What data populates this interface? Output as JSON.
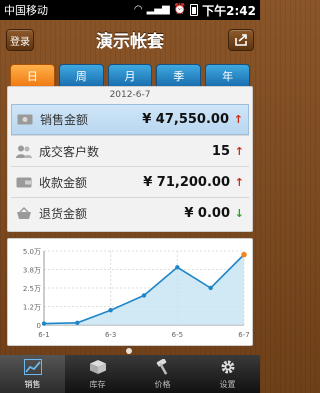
{
  "status_bar": {
    "carrier": "中国移动",
    "time": "下午2:42"
  },
  "header": {
    "left_button": "登录",
    "title": "演示帐套"
  },
  "period_tabs": [
    "日",
    "周",
    "月",
    "季",
    "年"
  ],
  "active_tab": "日",
  "summary": {
    "date": "2012-6-7",
    "rows": [
      {
        "icon": "cash-icon",
        "label": "销售金额",
        "value": "¥ 47,550.00",
        "trend": "↑"
      },
      {
        "icon": "customers-icon",
        "label": "成交客户数",
        "value": "15",
        "trend": "↑"
      },
      {
        "icon": "wallet-icon",
        "label": "收款金额",
        "value": "¥ 71,200.00",
        "trend": "↑"
      },
      {
        "icon": "basket-icon",
        "label": "退货金额",
        "value": "¥ 0.00",
        "trend": "↓"
      }
    ]
  },
  "chart_data": {
    "type": "area",
    "x": [
      "6-1",
      "6-2",
      "6-3",
      "6-4",
      "6-5",
      "6-6",
      "6-7"
    ],
    "x_tick_labels": [
      "6-1",
      "6-3",
      "6-5",
      "6-7"
    ],
    "y_tick_labels": [
      "0",
      "1.2万",
      "2.5万",
      "3.8万",
      "5.0万"
    ],
    "y_ticks": [
      0,
      12500,
      25000,
      37500,
      50000
    ],
    "values": [
      1000,
      1500,
      10000,
      20000,
      39000,
      25000,
      47550
    ],
    "ylim": [
      0,
      50000
    ],
    "colors": {
      "line": "#1f86c9",
      "fill": "#c6e2f2",
      "last_point": "#f0861c",
      "point": "#1f86c9"
    }
  },
  "bottom_tabs": [
    {
      "icon": "chart-icon",
      "label": "销售"
    },
    {
      "icon": "box-icon",
      "label": "库存"
    },
    {
      "icon": "hammer-icon",
      "label": "价格"
    },
    {
      "icon": "gear-icon",
      "label": "设置"
    }
  ]
}
